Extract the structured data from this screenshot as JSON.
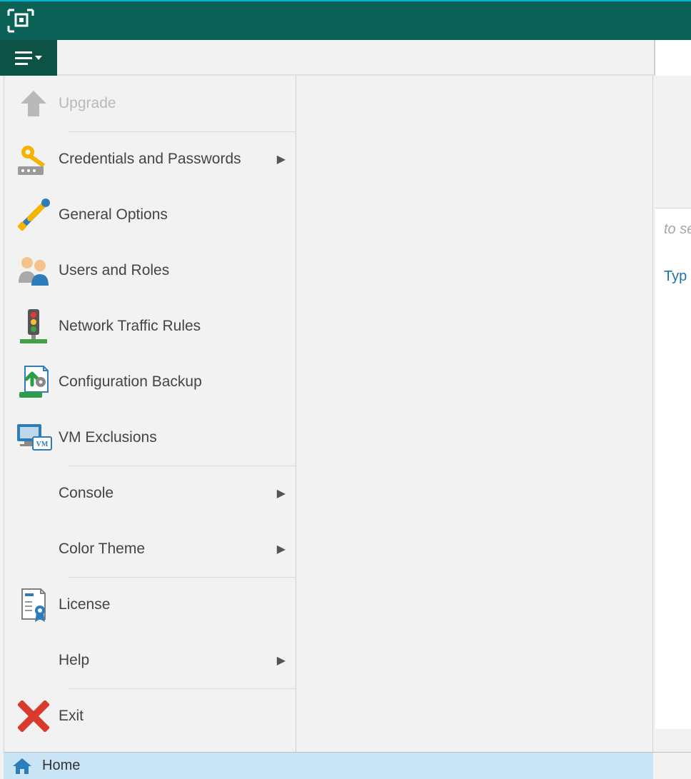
{
  "menu": {
    "items": [
      {
        "label": "Upgrade",
        "disabled": true,
        "submenu": false,
        "icon": "arrow-up",
        "sep": false
      },
      {
        "label": "Credentials and Passwords",
        "disabled": false,
        "submenu": true,
        "icon": "key",
        "sep": true
      },
      {
        "label": "General Options",
        "disabled": false,
        "submenu": false,
        "icon": "tools",
        "sep": false
      },
      {
        "label": "Users and Roles",
        "disabled": false,
        "submenu": false,
        "icon": "users",
        "sep": false
      },
      {
        "label": "Network Traffic Rules",
        "disabled": false,
        "submenu": false,
        "icon": "traffic",
        "sep": false
      },
      {
        "label": "Configuration Backup",
        "disabled": false,
        "submenu": false,
        "icon": "cfg-backup",
        "sep": false
      },
      {
        "label": "VM Exclusions",
        "disabled": false,
        "submenu": false,
        "icon": "vm",
        "sep": false
      },
      {
        "label": "Console",
        "disabled": false,
        "submenu": true,
        "icon": "",
        "sep": true
      },
      {
        "label": "Color Theme",
        "disabled": false,
        "submenu": true,
        "icon": "",
        "sep": false
      },
      {
        "label": "License",
        "disabled": false,
        "submenu": false,
        "icon": "license",
        "sep": true
      },
      {
        "label": "Help",
        "disabled": false,
        "submenu": true,
        "icon": "",
        "sep": false
      },
      {
        "label": "Exit",
        "disabled": false,
        "submenu": false,
        "icon": "exit",
        "sep": true
      }
    ]
  },
  "content": {
    "search_hint": "to se",
    "column_header": "Typ"
  },
  "nav": {
    "home_label": "Home"
  }
}
